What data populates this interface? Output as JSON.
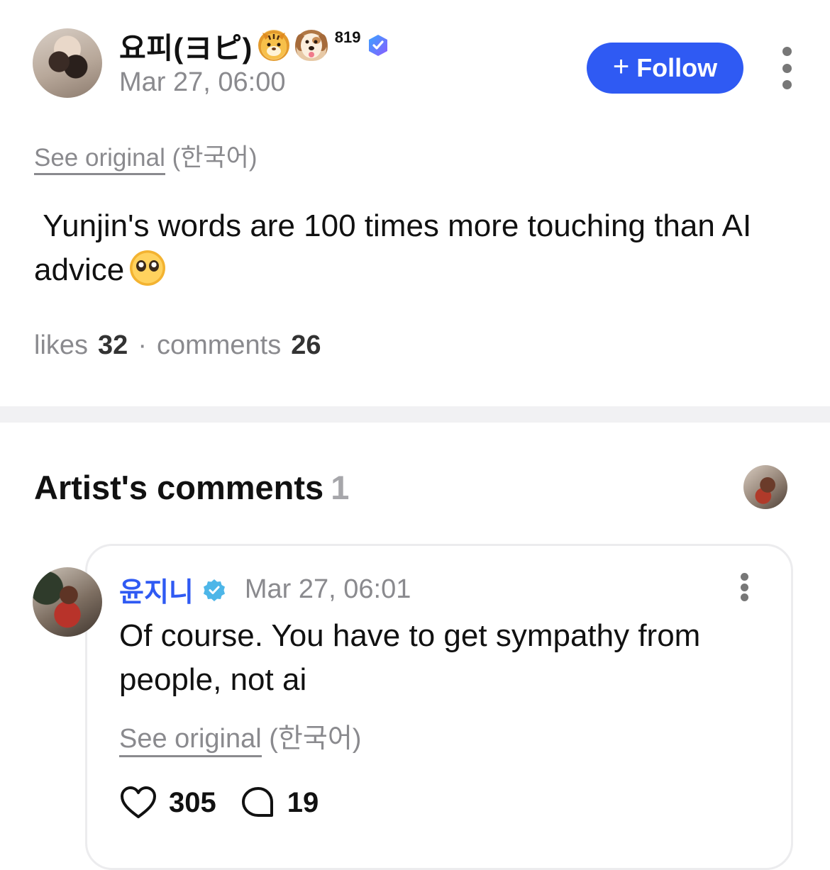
{
  "post": {
    "author_name": "요피(ヨピ)",
    "author_emojis": [
      "tiger-face-emoji",
      "dog-face-emoji"
    ],
    "author_level": "819",
    "date": "Mar 27, 06:00",
    "follow_label": "Follow",
    "see_original_label": "See original",
    "original_language": "(한국어)",
    "body": " Yunjin's words are 100 times more touching than AI advice",
    "body_emoji": "pleading-face-emoji",
    "likes_label": "likes",
    "likes_count": "32",
    "separator": "·",
    "comments_label": "comments",
    "comments_count": "26"
  },
  "artist_comments": {
    "title": "Artist's comments",
    "count": "1",
    "comment": {
      "author": "윤지니",
      "date": "Mar 27, 06:01",
      "body": "Of course. You have to get sympathy from people, not ai",
      "see_original_label": "See original",
      "original_language": "(한국어)",
      "likes": "305",
      "replies": "19"
    }
  },
  "colors": {
    "accent": "#2f5af3",
    "muted_text": "#8a8a8e",
    "verified": "#4db6e8"
  }
}
